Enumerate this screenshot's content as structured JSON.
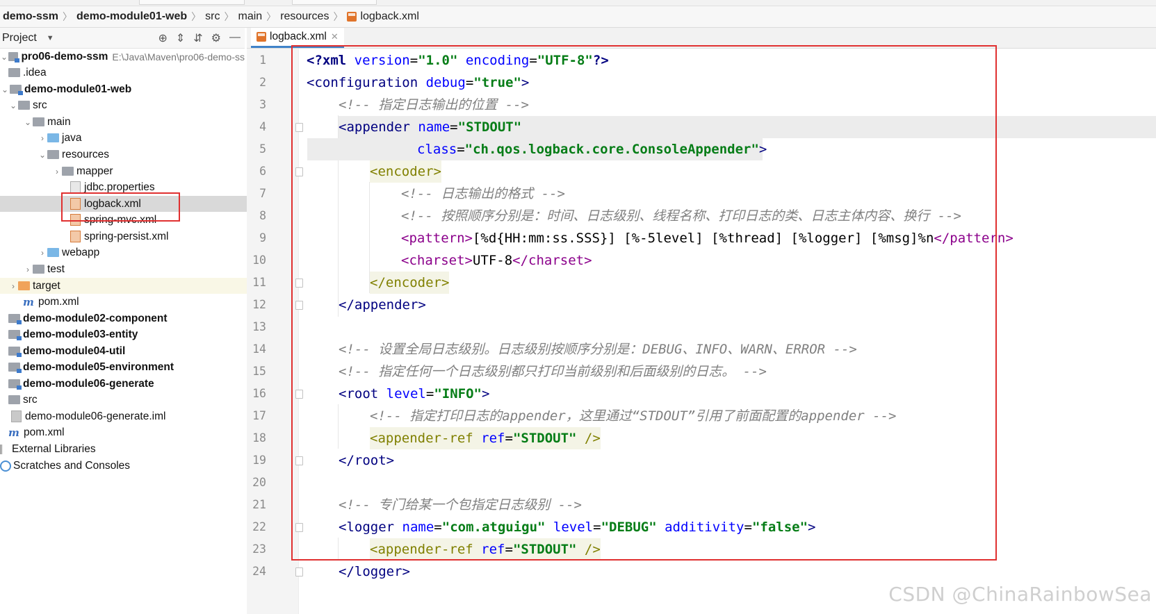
{
  "breadcrumb": [
    "demo-ssm",
    "demo-module01-web",
    "src",
    "main",
    "resources",
    "logback.xml"
  ],
  "project_panel": {
    "title": "Project",
    "tree": [
      {
        "label": "pro06-demo-ssm",
        "path": "E:\\Java\\Maven\\pro06-demo-ss",
        "bold": true
      },
      {
        "label": ".idea"
      },
      {
        "label": "demo-module01-web",
        "bold": true
      },
      {
        "label": "src"
      },
      {
        "label": "main"
      },
      {
        "label": "java"
      },
      {
        "label": "resources"
      },
      {
        "label": "mapper"
      },
      {
        "label": "jdbc.properties"
      },
      {
        "label": "logback.xml"
      },
      {
        "label": "spring-mvc.xml"
      },
      {
        "label": "spring-persist.xml"
      },
      {
        "label": "webapp"
      },
      {
        "label": "test"
      },
      {
        "label": "target"
      },
      {
        "label": "pom.xml"
      },
      {
        "label": "demo-module02-component",
        "bold": true
      },
      {
        "label": "demo-module03-entity",
        "bold": true
      },
      {
        "label": "demo-module04-util",
        "bold": true
      },
      {
        "label": "demo-module05-environment",
        "bold": true
      },
      {
        "label": "demo-module06-generate",
        "bold": true
      },
      {
        "label": "src"
      },
      {
        "label": "demo-module06-generate.iml"
      },
      {
        "label": "pom.xml"
      },
      {
        "label": "External Libraries"
      },
      {
        "label": "Scratches and Consoles"
      }
    ]
  },
  "editor": {
    "tab_label": "logback.xml",
    "line_numbers": [
      "1",
      "2",
      "3",
      "4",
      "5",
      "6",
      "7",
      "8",
      "9",
      "10",
      "11",
      "12",
      "13",
      "14",
      "15",
      "16",
      "17",
      "18",
      "19",
      "20",
      "21",
      "22",
      "23",
      "24"
    ],
    "lines": {
      "l1": {
        "b1": "<?",
        "t": "xml",
        "a1": " version",
        "e1": "=",
        "v1": "\"1.0\"",
        "a2": " encoding",
        "e2": "=",
        "v2": "\"UTF-8\"",
        "b2": "?>"
      },
      "l2": {
        "b1": "<",
        "t": "configuration",
        "a1": " debug",
        "e1": "=",
        "v1": "\"true\"",
        "b2": ">"
      },
      "l3": {
        "c": "<!-- 指定日志输出的位置 -->"
      },
      "l4": {
        "b1": "<",
        "t": "appender",
        "a1": " name",
        "e1": "=",
        "v1": "\"STDOUT\""
      },
      "l5": {
        "a1": "class",
        "e1": "=",
        "v1": "\"ch.qos.logback.core.ConsoleAppender\"",
        "b2": ">"
      },
      "l6": {
        "t": "<encoder>"
      },
      "l7": {
        "c": "<!-- 日志输出的格式 -->"
      },
      "l8": {
        "c": "<!-- 按照顺序分别是：时间、日志级别、线程名称、打印日志的类、日志主体内容、换行 -->"
      },
      "l9": {
        "t1": "<pattern>",
        "x": "[%d{HH:mm:ss.SSS}] [%-5level] [%thread] [%logger] [%msg]%n",
        "t2": "</pattern>"
      },
      "l10": {
        "t1": "<charset>",
        "x": "UTF-8",
        "t2": "</charset>"
      },
      "l11": {
        "t": "</encoder>"
      },
      "l12": {
        "b1": "</",
        "t": "appender",
        "b2": ">"
      },
      "l14": {
        "c": "<!-- 设置全局日志级别。日志级别按顺序分别是：DEBUG、INFO、WARN、ERROR -->"
      },
      "l15": {
        "c": "<!-- 指定任何一个日志级别都只打印当前级别和后面级别的日志。 -->"
      },
      "l16": {
        "b1": "<",
        "t": "root",
        "a1": " level",
        "e1": "=",
        "v1": "\"INFO\"",
        "b2": ">"
      },
      "l17": {
        "c": "<!-- 指定打印日志的appender，这里通过“STDOUT”引用了前面配置的appender -->"
      },
      "l18": {
        "t": "<appender-ref",
        "a1": " ref",
        "e1": "=",
        "v1": "\"STDOUT\"",
        "b2": " />"
      },
      "l19": {
        "b1": "</",
        "t": "root",
        "b2": ">"
      },
      "l21": {
        "c": "<!-- 专门给某一个包指定日志级别 -->"
      },
      "l22": {
        "b1": "<",
        "t": "logger",
        "a1": " name",
        "e1": "=",
        "v1": "\"com.atguigu\"",
        "a2": " level",
        "e2": "=",
        "v2": "\"DEBUG\"",
        "a3": " additivity",
        "e3": "=",
        "v3": "\"false\"",
        "b2": ">"
      },
      "l23": {
        "t": "<appender-ref",
        "a1": " ref",
        "e1": "=",
        "v1": "\"STDOUT\"",
        "b2": " />"
      },
      "l24": {
        "b1": "</",
        "t": "logger",
        "b2": ">"
      }
    }
  },
  "watermark": "CSDN @ChinaRainbowSea",
  "colors": {
    "highlight_box": "#e03030",
    "tag": "#000080",
    "attr": "#0000ff",
    "value": "#067d17",
    "comment": "#808080",
    "encoder_tag": "#808000",
    "pattern_tag": "#8b008b"
  }
}
